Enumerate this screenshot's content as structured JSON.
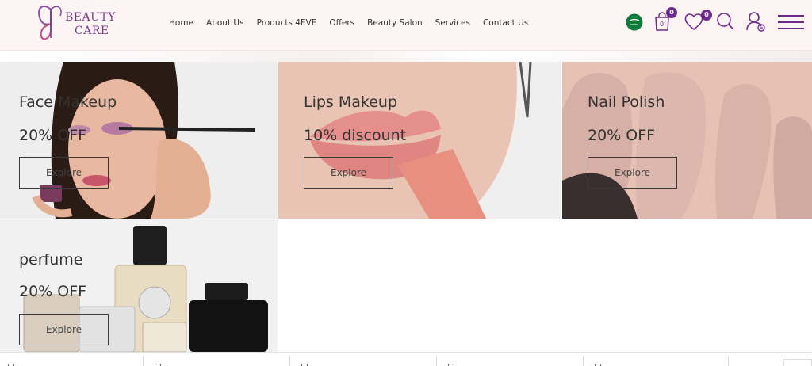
{
  "brand": {
    "logo_line1": "BEAUTY",
    "logo_line2": "CARE",
    "logo_color": "#7b3b8c"
  },
  "nav": {
    "items": [
      "Home",
      "About Us",
      "Products 4EVE",
      "Offers",
      "Beauty Salon",
      "Services",
      "Contact Us"
    ]
  },
  "header_icons": {
    "language_flag": "saudi-flag-icon",
    "cart_count": "0",
    "cart_inner_count": "0",
    "wishlist_count": "0",
    "search": "search-icon",
    "account": "user-icon",
    "menu": "hamburger-icon",
    "accent": "#6e2a8c"
  },
  "tiles": [
    {
      "title": "Face Makeup",
      "offer": "20% OFF",
      "button": "Explore"
    },
    {
      "title": "Lips Makeup",
      "offer": "10% discount",
      "button": "Explore"
    },
    {
      "title": "Nail Polish",
      "offer": "20% OFF",
      "button": "Explore"
    },
    {
      "title": "perfume",
      "offer": "20% OFF",
      "button": "Explore"
    }
  ]
}
